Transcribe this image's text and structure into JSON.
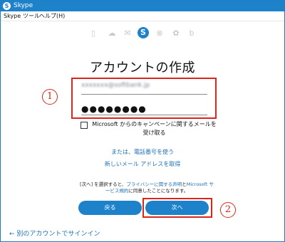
{
  "window": {
    "title": "Skype",
    "app_icon": "S"
  },
  "menu": [
    "Skype",
    "ツール",
    "ヘルプ(H)"
  ],
  "services": [
    {
      "name": "office-icon",
      "glyph": "▯"
    },
    {
      "name": "onedrive-icon",
      "glyph": "☁"
    },
    {
      "name": "outlook-icon",
      "glyph": "✉"
    },
    {
      "name": "skype-icon",
      "glyph": "S"
    },
    {
      "name": "xbox-icon",
      "glyph": "⊗"
    },
    {
      "name": "msn-icon",
      "glyph": "✿"
    },
    {
      "name": "bing-icon",
      "glyph": "b"
    }
  ],
  "page": {
    "title": "アカウントの作成"
  },
  "form": {
    "email_value": "xxxxxxx@softbank.jp",
    "password_value": "●●●●●●●●",
    "checkbox_label": "Microsoft からのキャンペーンに関するメールを受け取る",
    "phone_link": "または、電話番号を使う",
    "new_email_link": "新しいメール アドレスを取得"
  },
  "terms": {
    "prefix": "[次へ] を選択すると、",
    "privacy_link": "プライバシーに関する声明",
    "middle": "と",
    "service_link": "Microsoft サービス規約",
    "suffix": "に同意したことになります。"
  },
  "buttons": {
    "back": "戻る",
    "next": "次へ"
  },
  "annotations": {
    "one": "1",
    "two": "2"
  },
  "footer": {
    "signin_link": "← 別のアカウントでサインイン"
  },
  "colors": {
    "accent": "#1e82cb",
    "annotation_red": "#d9261c",
    "link": "#1e6fb8"
  }
}
